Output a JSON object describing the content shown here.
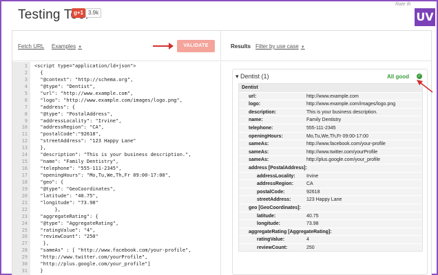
{
  "header": {
    "title": "Testing Tool",
    "gplus_label": "g+1",
    "gplus_count": "3.9k",
    "rate_text": "Rate th",
    "uv_badge": "UV"
  },
  "toolbar": {
    "fetch_url": "Fetch URL",
    "examples": "Examples",
    "validate": "VALIDATE",
    "results": "Results",
    "filter": "Filter by use case"
  },
  "code": [
    {
      "n": "1",
      "t": "<script type=\"application/ld+json\">"
    },
    {
      "n": "2",
      "t": "  {"
    },
    {
      "n": "3",
      "t": "  \"@context\": \"http://schema.org\","
    },
    {
      "n": "4",
      "t": "  \"@type\": \"Dentist\","
    },
    {
      "n": "5",
      "t": "  \"url\": \"http://www.example.com\","
    },
    {
      "n": "6",
      "t": "  \"logo\": \"http://www.example.com/images/logo.png\","
    },
    {
      "n": "7",
      "t": "  \"address\": {"
    },
    {
      "n": "8",
      "t": "  \"@type\": \"PostalAddress\","
    },
    {
      "n": "9",
      "t": "  \"addressLocality\": \"Irvine\","
    },
    {
      "n": "10",
      "t": "  \"addressRegion\": \"CA\","
    },
    {
      "n": "11",
      "t": "  \"postalCode\":\"92618\","
    },
    {
      "n": "12",
      "t": "  \"streetAddress\": \"123 Happy Lane\""
    },
    {
      "n": "13",
      "t": "  },"
    },
    {
      "n": "14",
      "t": "  \"description\": \"This is your business description.\","
    },
    {
      "n": "15",
      "t": "  \"name\": \"Family Dentistry\","
    },
    {
      "n": "16",
      "t": "  \"telephone\": \"555-111-2345\","
    },
    {
      "n": "17",
      "t": "  \"openingHours\": \"Mo,Tu,We,Th,Fr 09:00-17:00\","
    },
    {
      "n": "18",
      "t": "  \"geo\": {"
    },
    {
      "n": "19",
      "t": "  \"@type\": \"GeoCoordinates\","
    },
    {
      "n": "20",
      "t": "  \"latitude\": \"40.75\","
    },
    {
      "n": "21",
      "t": "  \"longitude\": \"73.98\""
    },
    {
      "n": "22",
      "t": "       },"
    },
    {
      "n": "23",
      "t": "  \"aggregateRating\": {"
    },
    {
      "n": "24",
      "t": "  \"@type\": \"AggregateRating\","
    },
    {
      "n": "25",
      "t": "  \"ratingValue\": \"4\","
    },
    {
      "n": "26",
      "t": "  \"reviewCount\": \"250\""
    },
    {
      "n": "27",
      "t": "   },"
    },
    {
      "n": "28",
      "t": "  \"sameAs\" : [ \"http://www.facebook.com/your-profile\","
    },
    {
      "n": "29",
      "t": "  \"http://www.twitter.com/yourProfile\","
    },
    {
      "n": "30",
      "t": "  \"http://plus.google.com/your_profile\"]"
    },
    {
      "n": "31",
      "t": "  }"
    }
  ],
  "results": {
    "title": "Dentist (1)",
    "status": "All good",
    "rows": [
      {
        "k": "Dentist",
        "v": "",
        "lvl": 0,
        "head": true
      },
      {
        "k": "url:",
        "v": "http://www.example.com",
        "lvl": 1
      },
      {
        "k": "logo:",
        "v": "http://www.example.com/images/logo.png",
        "lvl": 1
      },
      {
        "k": "description:",
        "v": "This is your business description.",
        "lvl": 1
      },
      {
        "k": "name:",
        "v": "Family Dentistry",
        "lvl": 1
      },
      {
        "k": "telephone:",
        "v": "555-111-2345",
        "lvl": 1
      },
      {
        "k": "openingHours:",
        "v": "Mo,Tu,We,Th,Fr 09:00-17:00",
        "lvl": 1
      },
      {
        "k": "sameAs:",
        "v": "http://www.facebook.com/your-profile",
        "lvl": 1
      },
      {
        "k": "sameAs:",
        "v": "http://www.twitter.com/yourProfile",
        "lvl": 1
      },
      {
        "k": "sameAs:",
        "v": "http://plus.google.com/your_profile",
        "lvl": 1
      },
      {
        "k": "address [PostalAddress]:",
        "v": "",
        "lvl": 1
      },
      {
        "k": "addressLocality:",
        "v": "Irvine",
        "lvl": 2
      },
      {
        "k": "addressRegion:",
        "v": "CA",
        "lvl": 2
      },
      {
        "k": "postalCode:",
        "v": "92618",
        "lvl": 2
      },
      {
        "k": "streetAddress:",
        "v": "123 Happy Lane",
        "lvl": 2
      },
      {
        "k": "geo [GeoCoordinates]:",
        "v": "",
        "lvl": 1
      },
      {
        "k": "latitude:",
        "v": "40.75",
        "lvl": 2
      },
      {
        "k": "longitude:",
        "v": "73.98",
        "lvl": 2
      },
      {
        "k": "aggregateRating [AggregateRating]:",
        "v": "",
        "lvl": 1
      },
      {
        "k": "ratingValue:",
        "v": "4",
        "lvl": 2
      },
      {
        "k": "reviewCount:",
        "v": "250",
        "lvl": 2
      }
    ]
  },
  "colors": {
    "validate_bg": "#f4a49b",
    "status_green": "#3a9b3a",
    "annotation_red": "#d32f2f",
    "uv_purple": "#7b41b9"
  }
}
